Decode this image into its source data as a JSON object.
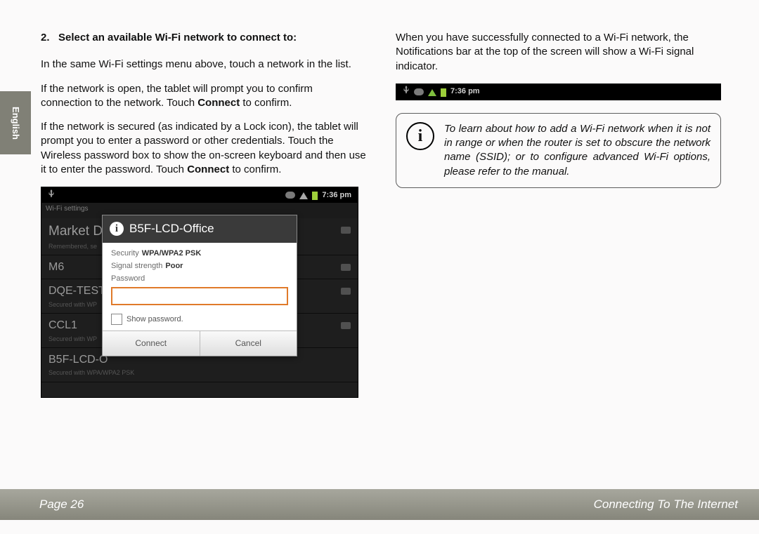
{
  "sidetab_label": "English",
  "left": {
    "heading": "2.   Select an available Wi-Fi network to connect to:",
    "p1": "In the same Wi-Fi settings menu above, touch a network in the list.",
    "p2_a": "If the network is open, the tablet will prompt you to confirm connection to the network. Touch ",
    "p2_b": "Connect",
    "p2_c": " to confirm.",
    "p3_a": "If the network is secured (as indicated by a Lock icon), the tablet will prompt you to enter a password or other credentials.  Touch the Wireless password box to show the on-screen keyboard and then use it to enter the password. Touch ",
    "p3_b": "Connect",
    "p3_c": " to confirm."
  },
  "screenshot": {
    "statusbar_time": "7:36 pm",
    "wifisettings_label": "Wi-Fi settings",
    "networks": [
      {
        "name": "Market Dep",
        "sub": "Remembered, se"
      },
      {
        "name": "M6",
        "sub": ""
      },
      {
        "name": "DQE-TEST",
        "sub": "Secured with WP"
      },
      {
        "name": "CCL1",
        "sub": "Secured with WP"
      },
      {
        "name": "B5F-LCD-O",
        "sub": "Secured with WPA/WPA2 PSK"
      }
    ],
    "dialog": {
      "title": "B5F-LCD-Office",
      "security_label": "Security",
      "security_value": "WPA/WPA2 PSK",
      "signal_label": "Signal strength",
      "signal_value": "Poor",
      "password_label": "Password",
      "show_password_label": "Show password.",
      "connect_label": "Connect",
      "cancel_label": "Cancel"
    }
  },
  "right": {
    "p1": "When you have successfully connected to a Wi-Fi network, the Notifications bar at the top of the screen will show a Wi-Fi signal indicator.",
    "statusbar_time": "7:36 pm",
    "info": "To learn about how to add a Wi-Fi network when it is not in range or when the router is set to obscure the network name (SSID); or to configure advanced Wi-Fi options, please refer to the manual."
  },
  "footer": {
    "page_label": "Page 26",
    "section_label": "Connecting To The Internet"
  }
}
